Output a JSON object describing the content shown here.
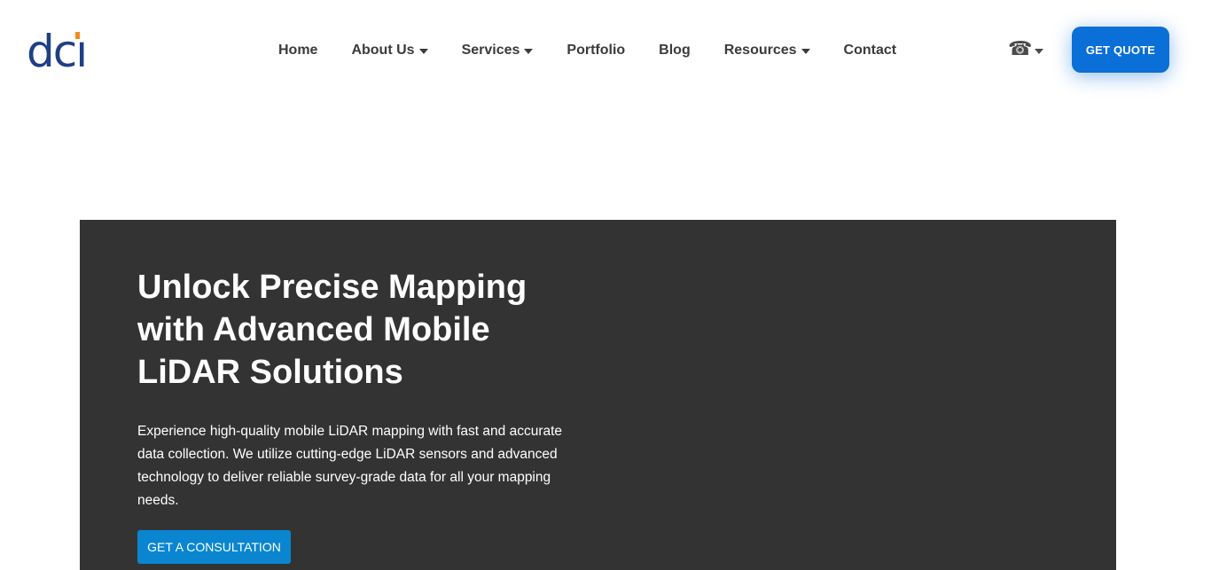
{
  "logo": {
    "text_main": "dc",
    "text_i": "ı"
  },
  "nav": {
    "items": [
      {
        "label": "Home",
        "dropdown": false
      },
      {
        "label": "About Us",
        "dropdown": true
      },
      {
        "label": "Services",
        "dropdown": true
      },
      {
        "label": "Portfolio",
        "dropdown": false
      },
      {
        "label": "Blog",
        "dropdown": false
      },
      {
        "label": "Resources",
        "dropdown": true
      },
      {
        "label": "Contact",
        "dropdown": false
      }
    ]
  },
  "phone": {
    "glyph": "☎",
    "icon": "phone-icon"
  },
  "quote_button": {
    "label": "GET QUOTE"
  },
  "hero": {
    "title": "Unlock Precise Mapping with Advanced Mobile LiDAR Solutions",
    "text": "Experience high-quality mobile LiDAR mapping with fast and accurate data collection. We utilize cutting-edge LiDAR sensors and advanced technology to deliver reliable survey-grade data for all your mapping needs.",
    "cta_label": "GET A CONSULTATION"
  },
  "colors": {
    "brand_blue": "#1f3f86",
    "accent_orange": "#f28c1f",
    "button_blue": "#0a6fd6",
    "cta_blue": "#0a86d0",
    "hero_bg": "#333333"
  }
}
